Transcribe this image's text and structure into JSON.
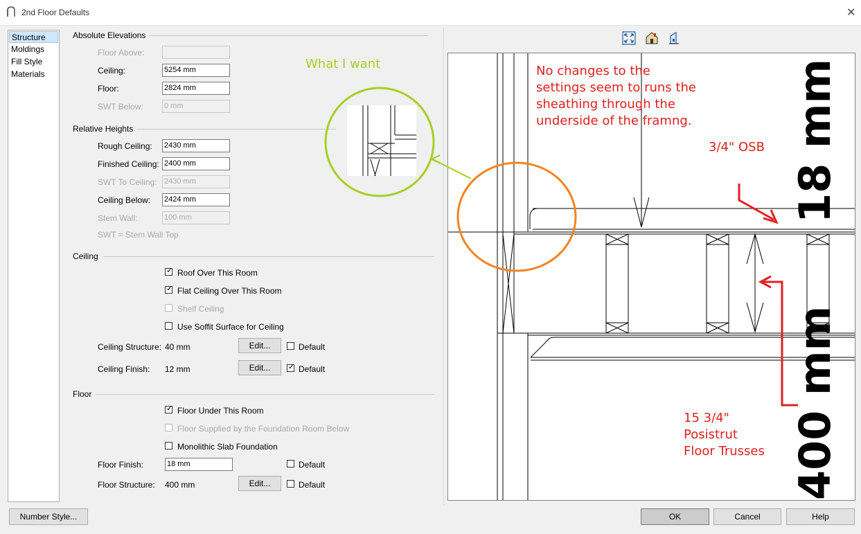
{
  "window": {
    "title": "2nd Floor Defaults",
    "close_glyph": "✕"
  },
  "nav": {
    "items": [
      "Structure",
      "Moldings",
      "Fill Style",
      "Materials"
    ],
    "selected": "Structure"
  },
  "absolute": {
    "heading": "Absolute Elevations",
    "floor_above_label": "Floor Above:",
    "floor_above_value": "",
    "ceiling_label": "Ceiling:",
    "ceiling_value": "5254 mm",
    "floor_label": "Floor:",
    "floor_value": "2824 mm",
    "swt_below_label": "SWT Below:",
    "swt_below_value": "0 mm"
  },
  "relative": {
    "heading": "Relative Heights",
    "rough_ceiling_label": "Rough Ceiling:",
    "rough_ceiling_value": "2430 mm",
    "finished_ceiling_label": "Finished Ceiling:",
    "finished_ceiling_value": "2400 mm",
    "swt_to_ceiling_label": "SWT To Ceiling:",
    "swt_to_ceiling_value": "2430 mm",
    "ceiling_below_label": "Ceiling Below:",
    "ceiling_below_value": "2424 mm",
    "stem_wall_label": "Stem Wall:",
    "stem_wall_value": "100 mm",
    "note": "SWT = Stem Wall Top"
  },
  "ceiling": {
    "heading": "Ceiling",
    "roof_over": "Roof Over This Room",
    "flat_ceiling": "Flat Ceiling Over This Room",
    "shelf_ceiling": "Shelf Ceiling",
    "soffit": "Use Soffit Surface for Ceiling",
    "structure_label": "Ceiling Structure:",
    "structure_value": "40 mm",
    "finish_label": "Ceiling Finish:",
    "finish_value": "12 mm",
    "edit": "Edit...",
    "default": "Default"
  },
  "floor": {
    "heading": "Floor",
    "under": "Floor Under This Room",
    "supplied": "Floor Supplied by the Foundation Room Below",
    "monolithic": "Monolithic Slab Foundation",
    "finish_label": "Floor Finish:",
    "finish_value": "18 mm",
    "structure_label": "Floor Structure:",
    "structure_value": "400 mm",
    "edit": "Edit...",
    "default": "Default"
  },
  "buttons": {
    "number_style": "Number Style...",
    "ok": "OK",
    "cancel": "Cancel",
    "help": "Help"
  },
  "annotations": {
    "what_i_want": "What I want",
    "note_line1": "No changes to the",
    "note_line2": "settings seem to runs the",
    "note_line3": "sheathing through the",
    "note_line4": "underside of the framng.",
    "osb": "3/4\" OSB",
    "truss_line1": "15 3/4\"",
    "truss_line2": "Posistrut",
    "truss_line3": "Floor Trusses",
    "dim_18": "18 mm",
    "dim_400": "400 mm"
  },
  "colors": {
    "annotation_red": "#e02020",
    "annotation_green": "#a6d021",
    "circle_orange": "#f58220",
    "selected": "#cde8ff"
  },
  "icons": [
    "fit-window-icon",
    "3d-view-icon",
    "elevation-view-icon"
  ]
}
